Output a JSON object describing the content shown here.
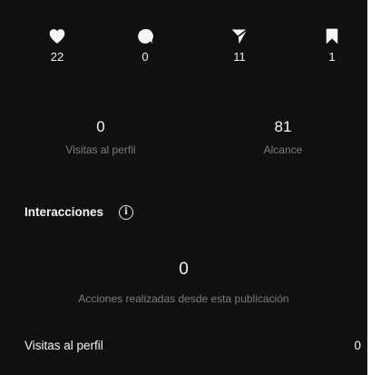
{
  "stats": {
    "likes": "22",
    "comments": "0",
    "shares": "11",
    "saves": "1"
  },
  "metrics": {
    "profile_visits_value": "0",
    "profile_visits_label": "Visitas al perfil",
    "reach_value": "81",
    "reach_label": "Alcance"
  },
  "interactions": {
    "title": "Interacciones",
    "actions_value": "0",
    "actions_label": "Acciones realizadas desde esta publicación",
    "row_label": "Visitas al perfil",
    "row_value": "0"
  },
  "icons": [
    "heart-icon",
    "comment-icon",
    "paper-plane-icon",
    "bookmark-icon",
    "info-icon"
  ],
  "colors": {
    "background": "#101010",
    "text": "#f5f5f5",
    "muted": "#7c7c7c"
  }
}
